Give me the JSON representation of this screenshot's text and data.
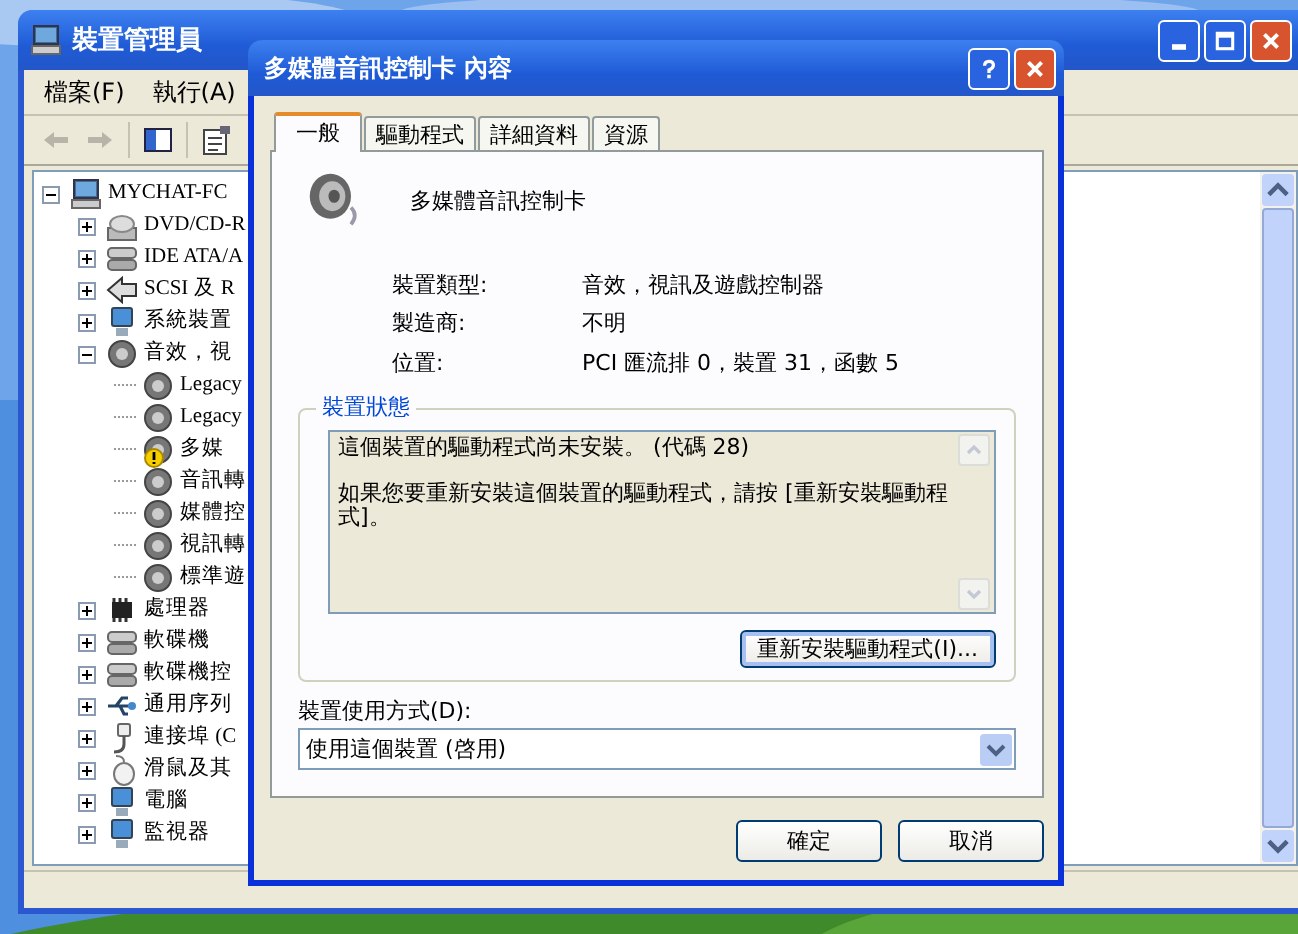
{
  "device_manager": {
    "title": "裝置管理員",
    "menu": [
      "檔案(F)",
      "執行(A)"
    ],
    "toolbar": [
      {
        "kind": "back",
        "disabled": true
      },
      {
        "kind": "forward",
        "disabled": true
      },
      {
        "kind": "tree",
        "disabled": false
      },
      {
        "kind": "properties",
        "disabled": false
      }
    ],
    "tree": [
      {
        "label": "MYCHAT-FC",
        "kind": "computer",
        "expanded": true,
        "children": [
          {
            "label": "DVD/CD-R",
            "kind": "disc",
            "expanded": false
          },
          {
            "label": "IDE ATA/A",
            "kind": "drive",
            "expanded": false
          },
          {
            "label": "SCSI 及 R",
            "kind": "scsi",
            "expanded": false
          },
          {
            "label": "系統裝置",
            "kind": "monitor",
            "expanded": false
          },
          {
            "label": "音效，視",
            "kind": "speaker",
            "expanded": true,
            "children": [
              {
                "label": "Legacy",
                "kind": "speaker",
                "problem": false
              },
              {
                "label": "Legacy",
                "kind": "speaker",
                "problem": false
              },
              {
                "label": "多媒",
                "kind": "speaker",
                "problem": true
              },
              {
                "label": "音訊轉",
                "kind": "speaker",
                "problem": false
              },
              {
                "label": "媒體控",
                "kind": "speaker",
                "problem": false
              },
              {
                "label": "視訊轉",
                "kind": "speaker",
                "problem": false
              },
              {
                "label": "標準遊",
                "kind": "speaker",
                "problem": false
              }
            ]
          },
          {
            "label": "處理器",
            "kind": "chip",
            "expanded": false
          },
          {
            "label": "軟碟機",
            "kind": "floppy",
            "expanded": false
          },
          {
            "label": "軟碟機控",
            "kind": "drive",
            "expanded": false
          },
          {
            "label": "通用序列",
            "kind": "usb",
            "expanded": false
          },
          {
            "label": "連接埠 (C",
            "kind": "plug",
            "expanded": false
          },
          {
            "label": "滑鼠及其",
            "kind": "mouse",
            "expanded": false
          },
          {
            "label": "電腦",
            "kind": "monitor",
            "expanded": false
          },
          {
            "label": "監視器",
            "kind": "monitor",
            "expanded": false
          }
        ]
      }
    ]
  },
  "dialog": {
    "title": "多媒體音訊控制卡 內容",
    "tabs": [
      {
        "label": "一般",
        "selected": true
      },
      {
        "label": "驅動程式",
        "selected": false
      },
      {
        "label": "詳細資料",
        "selected": false
      },
      {
        "label": "資源",
        "selected": false
      }
    ],
    "device_name": "多媒體音訊控制卡",
    "properties": [
      {
        "label": "裝置類型:",
        "value": "音效，視訊及遊戲控制器"
      },
      {
        "label": "製造商:",
        "value": "不明"
      },
      {
        "label": "位置:",
        "value": "PCI 匯流排 0，裝置 31，函數 5"
      }
    ],
    "status_group": "裝置狀態",
    "status_text": [
      "這個裝置的驅動程式尚未安裝。 (代碼 28)",
      "如果您要重新安裝這個裝置的驅動程式，請按 [重新安裝驅動程式]。"
    ],
    "reinstall_button": "重新安裝驅動程式(I)...",
    "usage_label": "裝置使用方式(D):",
    "usage_value": "使用這個裝置 (啓用)",
    "buttons": [
      "確定",
      "取消"
    ]
  }
}
